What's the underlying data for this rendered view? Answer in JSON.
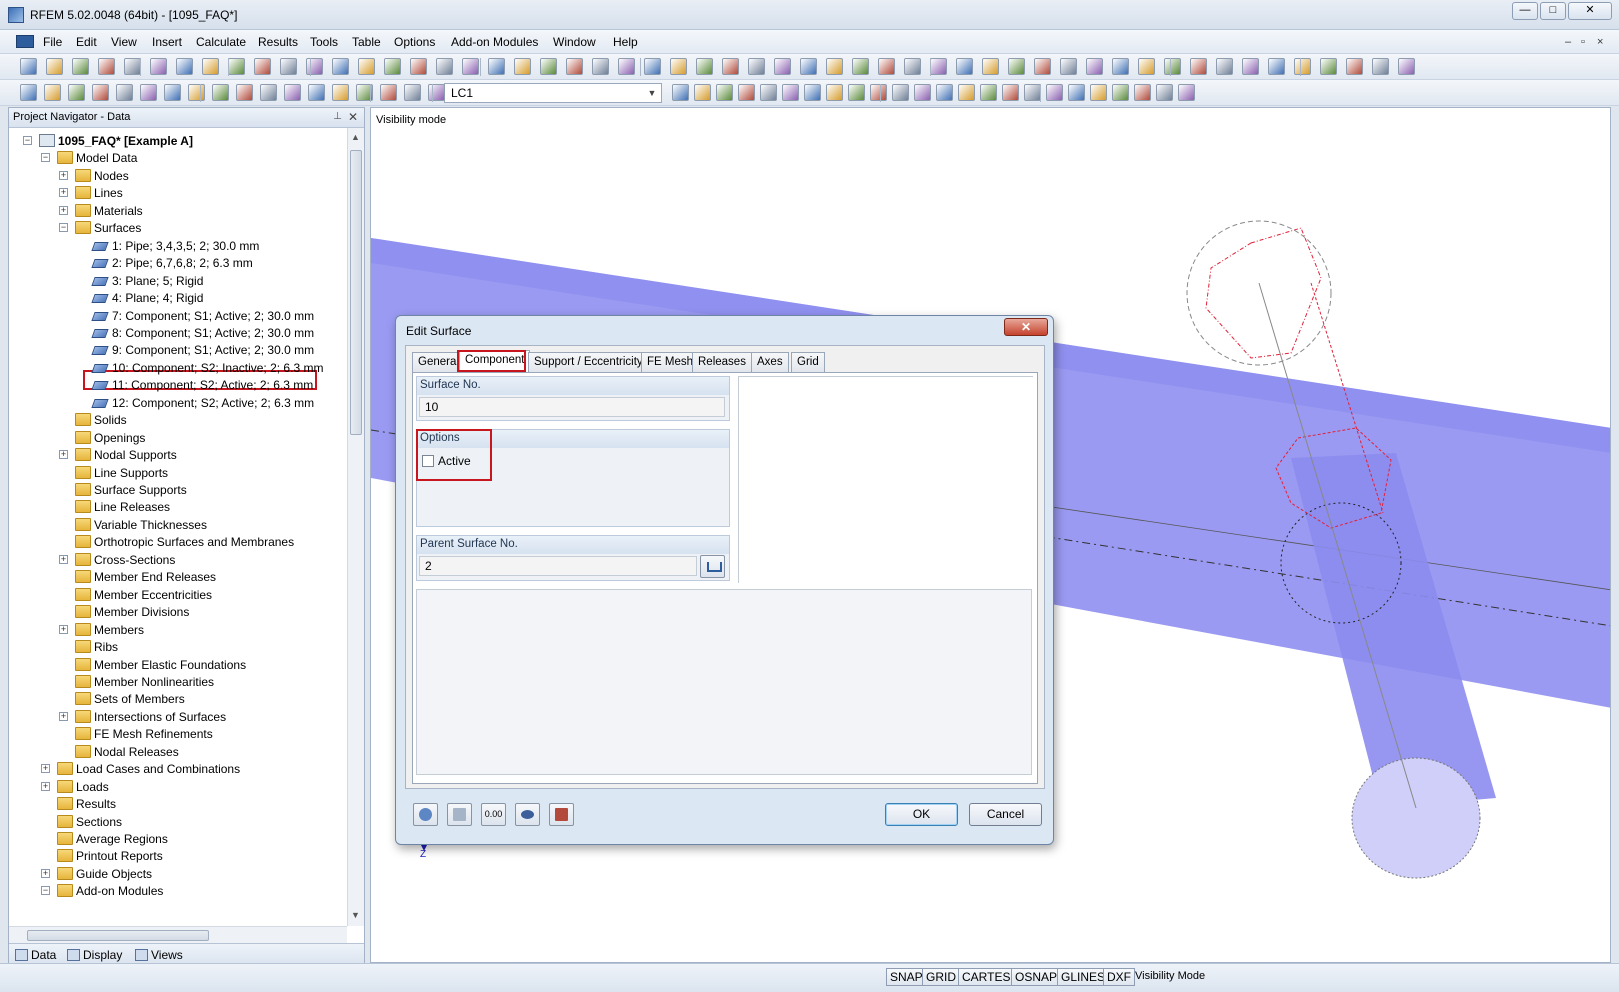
{
  "window": {
    "title": "RFEM 5.02.0048 (64bit) - [1095_FAQ*]",
    "min": "—",
    "max": "□",
    "close": "✕"
  },
  "menu": [
    "File",
    "Edit",
    "View",
    "Insert",
    "Calculate",
    "Results",
    "Tools",
    "Table",
    "Options",
    "Add-on Modules",
    "Window",
    "Help"
  ],
  "toolbar": {
    "load_case": "LC1"
  },
  "navigator": {
    "title": "Project Navigator - Data",
    "tree": [
      {
        "label": "1095_FAQ* [Example A]",
        "level": 0,
        "icon": "project-icon",
        "expander": "minus",
        "bold": true
      },
      {
        "label": "Model Data",
        "level": 1,
        "icon": "folder-icon",
        "expander": "minus"
      },
      {
        "label": "Nodes",
        "level": 2,
        "icon": "folder-icon",
        "expander": "plus"
      },
      {
        "label": "Lines",
        "level": 2,
        "icon": "folder-icon",
        "expander": "plus"
      },
      {
        "label": "Materials",
        "level": 2,
        "icon": "folder-icon",
        "expander": "plus"
      },
      {
        "label": "Surfaces",
        "level": 2,
        "icon": "folder-icon",
        "expander": "minus"
      },
      {
        "label": "1: Pipe; 3,4,3,5; 2; 30.0 mm",
        "level": 3,
        "icon": "surface-icon"
      },
      {
        "label": "2: Pipe; 6,7,6,8; 2; 6.3 mm",
        "level": 3,
        "icon": "surface-icon"
      },
      {
        "label": "3: Plane; 5; Rigid",
        "level": 3,
        "icon": "surface-icon"
      },
      {
        "label": "4: Plane; 4; Rigid",
        "level": 3,
        "icon": "surface-icon"
      },
      {
        "label": "7: Component; S1; Active; 2; 30.0 mm",
        "level": 3,
        "icon": "surface-icon"
      },
      {
        "label": "8: Component; S1; Active; 2; 30.0 mm",
        "level": 3,
        "icon": "surface-icon"
      },
      {
        "label": "9: Component; S1; Active; 2; 30.0 mm",
        "level": 3,
        "icon": "surface-icon"
      },
      {
        "label": "10: Component; S2; Inactive; 2; 6.3 mm",
        "level": 3,
        "icon": "surface-icon",
        "selected": true
      },
      {
        "label": "11: Component; S2; Active; 2; 6.3 mm",
        "level": 3,
        "icon": "surface-icon"
      },
      {
        "label": "12: Component; S2; Active; 2; 6.3 mm",
        "level": 3,
        "icon": "surface-icon"
      },
      {
        "label": "Solids",
        "level": 2,
        "icon": "folder-icon"
      },
      {
        "label": "Openings",
        "level": 2,
        "icon": "folder-icon"
      },
      {
        "label": "Nodal Supports",
        "level": 2,
        "icon": "folder-icon",
        "expander": "plus"
      },
      {
        "label": "Line Supports",
        "level": 2,
        "icon": "folder-icon"
      },
      {
        "label": "Surface Supports",
        "level": 2,
        "icon": "folder-icon"
      },
      {
        "label": "Line Releases",
        "level": 2,
        "icon": "folder-icon"
      },
      {
        "label": "Variable Thicknesses",
        "level": 2,
        "icon": "folder-icon"
      },
      {
        "label": "Orthotropic Surfaces and Membranes",
        "level": 2,
        "icon": "folder-icon"
      },
      {
        "label": "Cross-Sections",
        "level": 2,
        "icon": "folder-icon",
        "expander": "plus"
      },
      {
        "label": "Member End Releases",
        "level": 2,
        "icon": "folder-icon"
      },
      {
        "label": "Member Eccentricities",
        "level": 2,
        "icon": "folder-icon"
      },
      {
        "label": "Member Divisions",
        "level": 2,
        "icon": "folder-icon"
      },
      {
        "label": "Members",
        "level": 2,
        "icon": "folder-icon",
        "expander": "plus"
      },
      {
        "label": "Ribs",
        "level": 2,
        "icon": "folder-icon"
      },
      {
        "label": "Member Elastic Foundations",
        "level": 2,
        "icon": "folder-icon"
      },
      {
        "label": "Member Nonlinearities",
        "level": 2,
        "icon": "folder-icon"
      },
      {
        "label": "Sets of Members",
        "level": 2,
        "icon": "folder-icon"
      },
      {
        "label": "Intersections of Surfaces",
        "level": 2,
        "icon": "folder-icon",
        "expander": "plus"
      },
      {
        "label": "FE Mesh Refinements",
        "level": 2,
        "icon": "folder-icon"
      },
      {
        "label": "Nodal Releases",
        "level": 2,
        "icon": "folder-icon"
      },
      {
        "label": "Load Cases and Combinations",
        "level": 1,
        "icon": "folder-icon",
        "expander": "plus"
      },
      {
        "label": "Loads",
        "level": 1,
        "icon": "folder-icon",
        "expander": "plus"
      },
      {
        "label": "Results",
        "level": 1,
        "icon": "folder-icon"
      },
      {
        "label": "Sections",
        "level": 1,
        "icon": "folder-icon"
      },
      {
        "label": "Average Regions",
        "level": 1,
        "icon": "folder-icon"
      },
      {
        "label": "Printout Reports",
        "level": 1,
        "icon": "folder-icon"
      },
      {
        "label": "Guide Objects",
        "level": 1,
        "icon": "folder-icon",
        "expander": "plus"
      },
      {
        "label": "Add-on Modules",
        "level": 1,
        "icon": "folder-icon",
        "expander": "minus"
      }
    ],
    "tabs": [
      "Data",
      "Display",
      "Views"
    ]
  },
  "viewport": {
    "mode_label": "Visibility mode",
    "axis_label": "Z"
  },
  "dialog": {
    "title": "Edit Surface",
    "tabs": [
      "General",
      "Component",
      "Support / Eccentricity",
      "FE Mesh",
      "Releases",
      "Axes",
      "Grid"
    ],
    "active_tab": "Component",
    "surface_no_label": "Surface No.",
    "surface_no_value": "10",
    "options_label": "Options",
    "active_checkbox_label": "Active",
    "active_checked": false,
    "parent_surface_label": "Parent Surface No.",
    "parent_surface_value": "2",
    "ok_label": "OK",
    "cancel_label": "Cancel",
    "icon_buttons": [
      "help-icon",
      "edit-icon",
      "units-icon",
      "view-icon",
      "export-icon"
    ],
    "units_button_text": "0.00"
  },
  "statusbar": {
    "buttons": [
      "SNAP",
      "GRID",
      "CARTES",
      "OSNAP",
      "GLINES",
      "DXF"
    ],
    "mode_text": "Visibility Mode"
  },
  "colors": {
    "highlight_red": "#c8161e",
    "pipe_fill": "#9a9af2",
    "accent_blue": "#2d5d9c"
  }
}
